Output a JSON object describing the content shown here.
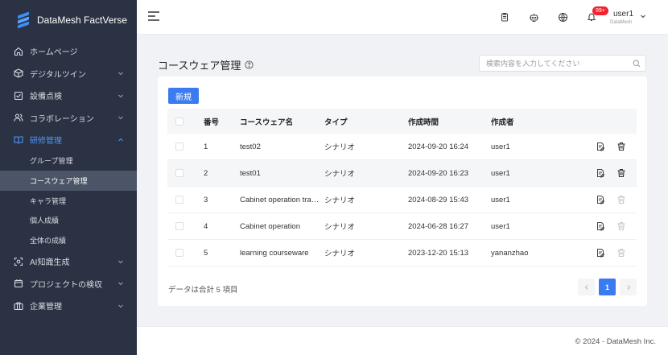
{
  "brand": {
    "name": "DataMesh FactVerse"
  },
  "sidebar": {
    "items": [
      {
        "label": "ホームページ",
        "icon": "home-icon",
        "has_children": false
      },
      {
        "label": "デジタルツイン",
        "icon": "cube-icon",
        "has_children": true
      },
      {
        "label": "設備点検",
        "icon": "checklist-icon",
        "has_children": true
      },
      {
        "label": "コラボレーション",
        "icon": "users-icon",
        "has_children": true
      },
      {
        "label": "研修管理",
        "icon": "book-icon",
        "has_children": true,
        "open": true
      }
    ],
    "sub_items": [
      {
        "label": "グループ管理"
      },
      {
        "label": "コースウェア管理",
        "active": true
      },
      {
        "label": "キャラ管理"
      },
      {
        "label": "個人成績"
      },
      {
        "label": "全体の成績"
      }
    ],
    "items_after": [
      {
        "label": "AI知識生成",
        "icon": "ai-icon",
        "has_children": true
      },
      {
        "label": "プロジェクトの検収",
        "icon": "calendar-icon",
        "has_children": true
      },
      {
        "label": "企業管理",
        "icon": "briefcase-icon",
        "has_children": true
      }
    ]
  },
  "topbar": {
    "badge": "99+",
    "user_name": "user1",
    "user_org": "DataMesh"
  },
  "page": {
    "title": "コースウェア管理",
    "search_placeholder": "検索内容を入力してください",
    "new_button": "新規",
    "total_text": "データは合計 5 項目",
    "current_page": "1"
  },
  "table": {
    "headers": {
      "no": "番号",
      "name": "コースウェア名",
      "type": "タイプ",
      "time": "作成時間",
      "creator": "作成者"
    },
    "rows": [
      {
        "no": "1",
        "name": "test02",
        "type": "シナリオ",
        "time": "2024-09-20 16:24",
        "creator": "user1",
        "deletable": true
      },
      {
        "no": "2",
        "name": "test01",
        "type": "シナリオ",
        "time": "2024-09-20 16:23",
        "creator": "user1",
        "deletable": true
      },
      {
        "no": "3",
        "name": "Cabinet operation training",
        "type": "シナリオ",
        "time": "2024-08-29 15:43",
        "creator": "user1",
        "deletable": false
      },
      {
        "no": "4",
        "name": "Cabinet operation",
        "type": "シナリオ",
        "time": "2024-06-28 16:27",
        "creator": "user1",
        "deletable": false
      },
      {
        "no": "5",
        "name": "learning courseware",
        "type": "シナリオ",
        "time": "2023-12-20 15:13",
        "creator": "yananzhao",
        "deletable": false
      }
    ]
  },
  "footer": {
    "text": "© 2024 - DataMesh Inc."
  },
  "colors": {
    "sidebar_bg": "#2b3243",
    "accent": "#3b7bf0",
    "badge": "#f5222d"
  }
}
